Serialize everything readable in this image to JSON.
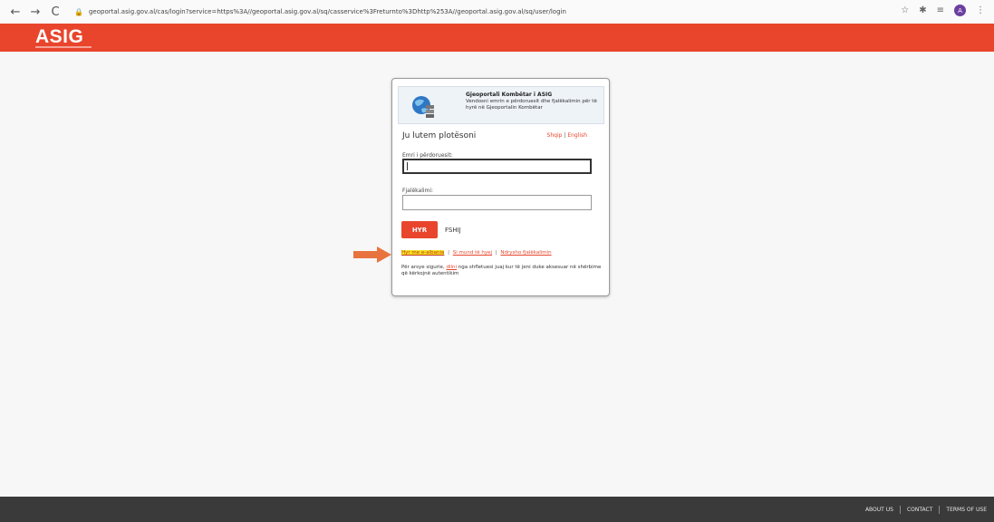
{
  "browser": {
    "back_icon": "←",
    "forward_icon": "→",
    "reload_icon": "C",
    "url": "geoportal.asig.gov.al/cas/login?service=https%3A//geoportal.asig.gov.al/sq/casservice%3Freturnto%3Dhttp%253A//geoportal.asig.gov.al/sq/user/login",
    "avatar_letter": "A"
  },
  "header": {
    "logo": "ASIG",
    "brand_color": "#e8452c"
  },
  "login": {
    "heading_title": "Gjeoportali Kombëtar i ASIG",
    "heading_text": "Vendosni emrin e përdoruesit dhe fjalëkalimin për të hyrë në Gjeoportalin Kombëtar",
    "prompt": "Ju lutem plotësoni",
    "lang_sq": "Shqip",
    "lang_sep": "|",
    "lang_en": "English",
    "username_label": "Emri i përdoruesit:",
    "username_value": "",
    "password_label": "Fjalëkalimi:",
    "password_value": "",
    "submit_label": "HYR",
    "clear_label": "FSHIJ",
    "link_register": "Hyr me e-albania",
    "link_sep1": "|",
    "link_forgot": "Si mund të hyej",
    "link_sep2": "|",
    "link_change": "Ndrysho fjalëkalimin",
    "help_prefix": "Për arsye sigurie,",
    "help_link": "dilni",
    "help_suffix": "nga shfletuesi juaj kur të jeni duke aksesuar në shërbime që kërkojnë autentikim"
  },
  "footer": {
    "about": "ABOUT US",
    "contact": "CONTACT",
    "terms": "TERMS OF USE"
  }
}
